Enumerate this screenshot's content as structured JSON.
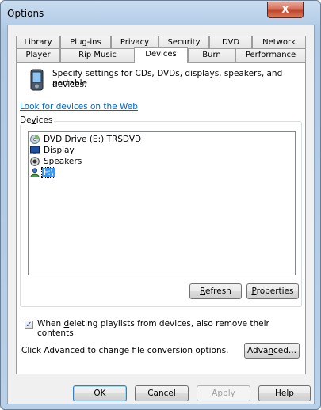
{
  "window": {
    "title": "Options",
    "close_label": "X"
  },
  "tabs_row1": [
    "Library",
    "Plug-ins",
    "Privacy",
    "Security",
    "DVD",
    "Network"
  ],
  "tabs_row2": [
    "Player",
    "Rip Music",
    "Devices",
    "Burn",
    "Performance"
  ],
  "active_tab": "Devices",
  "panel": {
    "description": "Specify settings for CDs, DVDs, displays, speakers, and portable devices.",
    "description_line1": "Specify settings for CDs, DVDs, displays, speakers, and portable",
    "description_line2": "devices.",
    "link": "Look for devices on the Web",
    "devices_group_label": "Devices",
    "devices": [
      {
        "label": "DVD Drive (E:) TRSDVD",
        "icon": "dvd-drive-icon",
        "selected": false
      },
      {
        "label": "Display",
        "icon": "monitor-icon",
        "selected": false
      },
      {
        "label": "Speakers",
        "icon": "speaker-icon",
        "selected": false
      },
      {
        "label": "F:\\",
        "icon": "portable-device-icon",
        "selected": true
      }
    ],
    "refresh_label": "Refresh",
    "properties_label": "Properties",
    "checkbox_label": "When deleting playlists from devices, also remove their contents",
    "checkbox_checked": true,
    "advanced_text": "Click Advanced to change file conversion options.",
    "advanced_label": "Advanced..."
  },
  "footer": {
    "ok": "OK",
    "cancel": "Cancel",
    "apply": "Apply",
    "help": "Help"
  }
}
